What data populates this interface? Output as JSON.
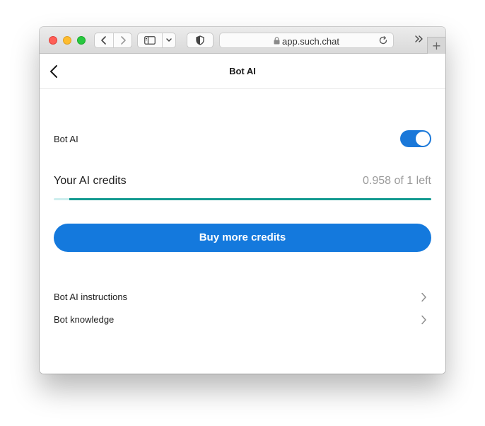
{
  "browser": {
    "url": "app.such.chat",
    "new_tab_label": "+"
  },
  "header": {
    "title": "Bot AI"
  },
  "settings": {
    "bot_ai_label": "Bot AI",
    "bot_ai_enabled": true
  },
  "credits": {
    "label": "Your AI credits",
    "remaining_text": "0.958 of 1 left",
    "remaining": 0.958,
    "total": 1
  },
  "buy_button": {
    "label": "Buy more credits"
  },
  "links": [
    {
      "label": "Bot AI instructions",
      "icon": "chevron-right-icon"
    },
    {
      "label": "Bot knowledge",
      "icon": "chevron-right-icon"
    }
  ],
  "colors": {
    "accent": "#1479dd",
    "progress": "#149a91",
    "progress_track": "#cdeeee",
    "muted_text": "#9b9b9b"
  }
}
